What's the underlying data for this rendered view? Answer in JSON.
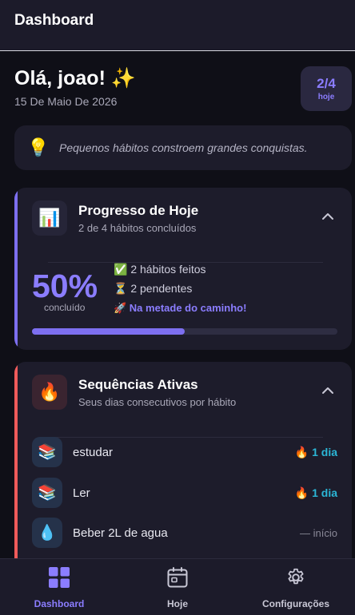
{
  "topbar": {
    "title": "Dashboard"
  },
  "greeting": {
    "title": "Olá, joao! ✨",
    "date": "15 De Maio De 2026"
  },
  "today_badge": {
    "count": "2/4",
    "label": "hoje"
  },
  "quote": {
    "icon": "💡",
    "text": "Pequenos hábitos constroem grandes conquistas."
  },
  "progress_card": {
    "icon": "📊",
    "title": "Progresso de Hoje",
    "subtitle": "2 de 4 hábitos concluídos",
    "percent_text": "50%",
    "percent_label": "concluído",
    "done_text": "✅ 2 hábitos feitos",
    "pending_text": "⏳ 2 pendentes",
    "status_text": "🚀 Na metade do caminho!",
    "progress_fraction": 0.5,
    "accent_color": "#7d6ff0"
  },
  "streaks_card": {
    "icon": "🔥",
    "title": "Sequências Ativas",
    "subtitle": "Seus dias consecutivos por hábito",
    "accent_color": "#ef5b5b",
    "items": [
      {
        "icon": "📚",
        "name": "estudar",
        "streak": "🔥 1 dia"
      },
      {
        "icon": "📚",
        "name": "Ler",
        "streak": "🔥 1 dia"
      },
      {
        "icon": "💧",
        "name": "Beber 2L de agua",
        "streak": "— início"
      }
    ]
  },
  "bottom_nav": {
    "items": [
      {
        "label": "Dashboard",
        "icon": "grid-icon",
        "active": true
      },
      {
        "label": "Hoje",
        "icon": "calendar-icon",
        "active": false
      },
      {
        "label": "Configurações",
        "icon": "gear-icon",
        "active": false
      }
    ],
    "active_color": "#8b7dff",
    "inactive_color": "#c9c8d6"
  }
}
